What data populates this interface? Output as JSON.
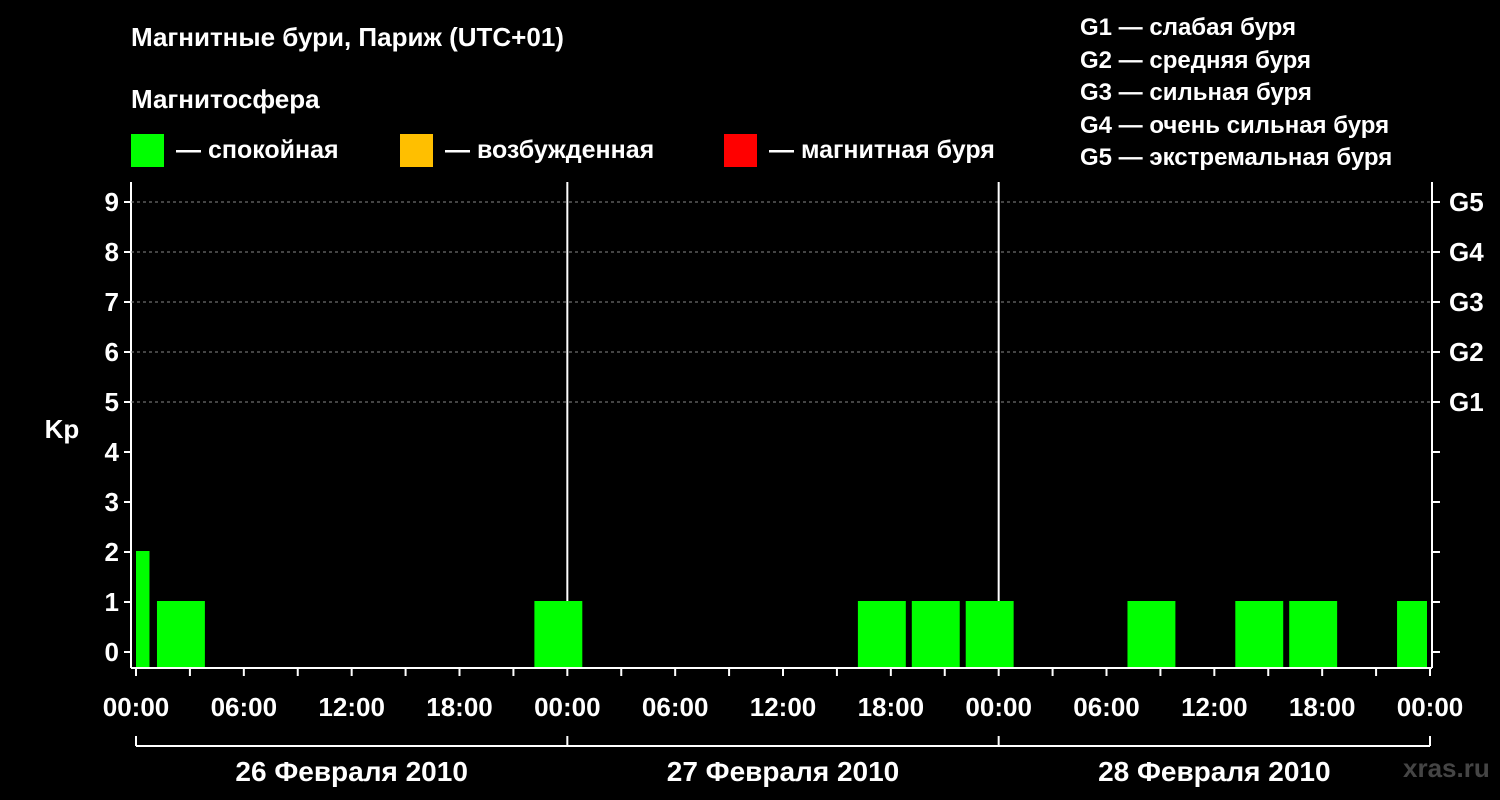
{
  "header": {
    "title": "Магнитные бури, Париж (UTC+01)",
    "subtitle": "Магнитосфера"
  },
  "status_legend": [
    {
      "label": "— спокойная",
      "color": "#00ff00"
    },
    {
      "label": "— возбужденная",
      "color": "#ffbf00"
    },
    {
      "label": "— магнитная буря",
      "color": "#ff0000"
    }
  ],
  "g_legend": [
    "G1 — слабая буря",
    "G2 — средняя буря",
    "G3 — сильная буря",
    "G4 — очень сильная буря",
    "G5 — экстремальная буря"
  ],
  "watermark": "xras.ru",
  "chart_data": {
    "type": "bar",
    "ylabel": "Kp",
    "ylim": [
      0,
      9
    ],
    "y_ticks": [
      "0",
      "1",
      "2",
      "3",
      "4",
      "5",
      "6",
      "7",
      "8",
      "9"
    ],
    "right_ticks": [
      {
        "value": 5,
        "label": "G1"
      },
      {
        "value": 6,
        "label": "G2"
      },
      {
        "value": 7,
        "label": "G3"
      },
      {
        "value": 8,
        "label": "G4"
      },
      {
        "value": 9,
        "label": "G5"
      }
    ],
    "x_ticks": [
      "00:00",
      "06:00",
      "12:00",
      "18:00",
      "00:00",
      "06:00",
      "12:00",
      "18:00",
      "00:00",
      "06:00",
      "12:00",
      "18:00",
      "00:00"
    ],
    "days": [
      "26 Февраля 2010",
      "27 Февраля 2010",
      "28 Февраля 2010"
    ],
    "grid": "dashed horizontal at Kp 5–9",
    "bars": [
      {
        "start_hour": 0,
        "end_hour": 0.75,
        "kp": 2,
        "color": "#00ff00"
      },
      {
        "start_hour": 1,
        "end_hour": 4,
        "kp": 1,
        "color": "#00ff00"
      },
      {
        "start_hour": 22,
        "end_hour": 25,
        "kp": 1,
        "color": "#00ff00"
      },
      {
        "start_hour": 40,
        "end_hour": 43,
        "kp": 1,
        "color": "#00ff00"
      },
      {
        "start_hour": 43,
        "end_hour": 46,
        "kp": 1,
        "color": "#00ff00"
      },
      {
        "start_hour": 46,
        "end_hour": 49,
        "kp": 1,
        "color": "#00ff00"
      },
      {
        "start_hour": 55,
        "end_hour": 58,
        "kp": 1,
        "color": "#00ff00"
      },
      {
        "start_hour": 61,
        "end_hour": 64,
        "kp": 1,
        "color": "#00ff00"
      },
      {
        "start_hour": 64,
        "end_hour": 67,
        "kp": 1,
        "color": "#00ff00"
      },
      {
        "start_hour": 70,
        "end_hour": 72,
        "kp": 1,
        "color": "#00ff00"
      }
    ]
  }
}
